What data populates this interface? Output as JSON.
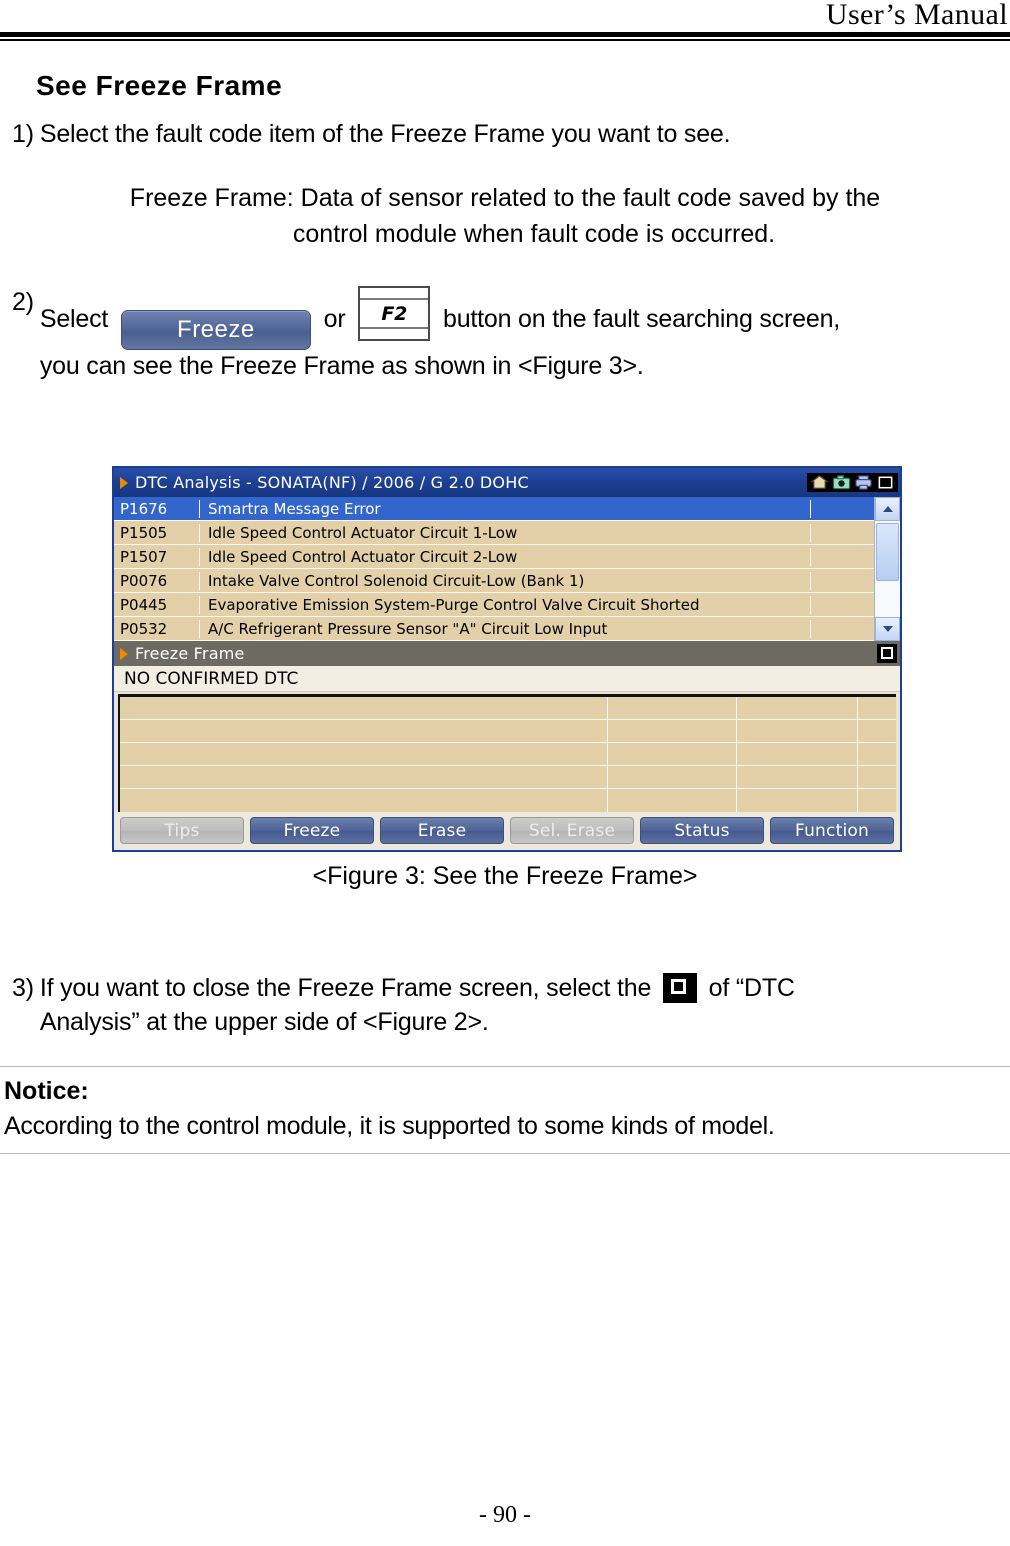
{
  "page": {
    "header_title": "User’s Manual",
    "footer": "- 90 -"
  },
  "section": {
    "heading": "See Freeze Frame"
  },
  "steps": {
    "step1_num": "1)",
    "step1_text": "Select the fault code item of the Freeze Frame you want to see.",
    "definition_line1": "Freeze Frame: Data of sensor related to the fault code saved by the",
    "definition_line2": "control module when fault code is occurred.",
    "step2_num": "2)",
    "step2_prefix": "Select",
    "step2_inline_button": "Freeze",
    "step2_or": "or",
    "step2_key": "F2",
    "step2_mid": "button on the fault searching screen,",
    "step2_line2": "you can see the Freeze Frame as shown in <Figure 3>.",
    "step3_num": "3)",
    "step3_prefix": "If you want to close the Freeze Frame screen, select the",
    "step3_suffix": "of “DTC",
    "step3_line2": "Analysis” at the upper side of <Figure 2>."
  },
  "figure": {
    "caption": "<Figure 3: See the Freeze Frame>"
  },
  "app": {
    "title": "DTC Analysis - SONATA(NF) / 2006 / G 2.0 DOHC",
    "titlebar_icons": [
      "home-icon",
      "camera-icon",
      "printer-icon",
      "restore-icon"
    ],
    "dtc_rows": [
      {
        "code": "P1676",
        "desc": "Smartra Message Error",
        "selected": true
      },
      {
        "code": "P1505",
        "desc": "Idle Speed Control Actuator Circuit 1-Low",
        "selected": false
      },
      {
        "code": "P1507",
        "desc": "Idle Speed Control Actuator Circuit 2-Low",
        "selected": false
      },
      {
        "code": "P0076",
        "desc": "Intake Valve Control Solenoid Circuit-Low (Bank 1)",
        "selected": false
      },
      {
        "code": "P0445",
        "desc": "Evaporative Emission System-Purge Control Valve Circuit Shorted",
        "selected": false
      },
      {
        "code": "P0532",
        "desc": "A/C Refrigerant Pressure Sensor \"A\" Circuit Low Input",
        "selected": false
      }
    ],
    "freeze_frame": {
      "panel_title": "Freeze Frame",
      "status_text": "NO CONFIRMED DTC",
      "empty_rows": 5
    },
    "buttons": [
      {
        "label": "Tips",
        "disabled": true
      },
      {
        "label": "Freeze",
        "disabled": false
      },
      {
        "label": "Erase",
        "disabled": false
      },
      {
        "label": "Sel. Erase",
        "disabled": true
      },
      {
        "label": "Status",
        "disabled": false
      },
      {
        "label": "Function",
        "disabled": false
      }
    ]
  },
  "notice": {
    "title": "Notice:",
    "text": "According to the control module, it is supported to some kinds of model."
  },
  "colors": {
    "titlebar_blue": "#1c3f94",
    "row_tan": "#e3cfa8",
    "selection_blue": "#3366cc",
    "panel_gray": "#6d6a62",
    "button_blue": "#4d6196",
    "bullet_orange": "#f08800"
  }
}
